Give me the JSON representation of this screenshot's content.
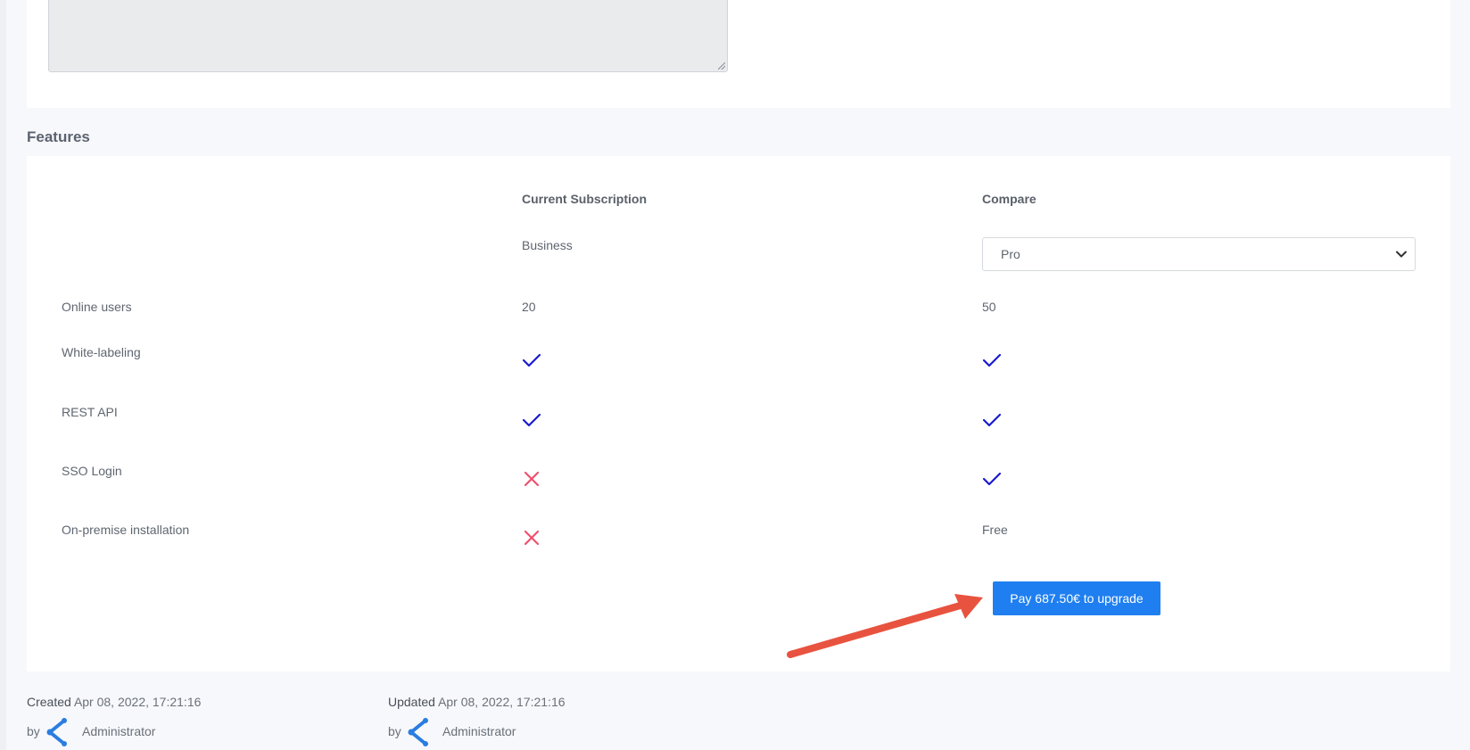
{
  "features": {
    "title": "Features",
    "headers": {
      "current": "Current Subscription",
      "compare": "Compare"
    },
    "current_plan": "Business",
    "compare_select": {
      "selected": "Pro"
    },
    "rows": [
      {
        "label": "Online users",
        "current": "20",
        "compare": "50"
      },
      {
        "label": "White-labeling",
        "current": "check",
        "compare": "check"
      },
      {
        "label": "REST API",
        "current": "check",
        "compare": "check"
      },
      {
        "label": "SSO Login",
        "current": "cross",
        "compare": "check"
      },
      {
        "label": "On-premise installation",
        "current": "cross",
        "compare": "Free"
      }
    ],
    "upgrade_button": "Pay 687.50€ to upgrade"
  },
  "footer": {
    "created_label": "Created",
    "created_date": "Apr 08, 2022, 17:21:16",
    "created_by_label": "by",
    "created_by": "Administrator",
    "updated_label": "Updated",
    "updated_date": "Apr 08, 2022, 17:21:16",
    "updated_by_label": "by",
    "updated_by": "Administrator"
  },
  "colors": {
    "accent": "#1f7ff0",
    "check": "#1a1ad0",
    "cross": "#f0506e",
    "annotation_arrow": "#e8533f"
  },
  "icons": {
    "check": "check-icon",
    "cross": "cross-icon",
    "select_caret": "chevron-down-icon",
    "avatar": "user-avatar-icon"
  }
}
